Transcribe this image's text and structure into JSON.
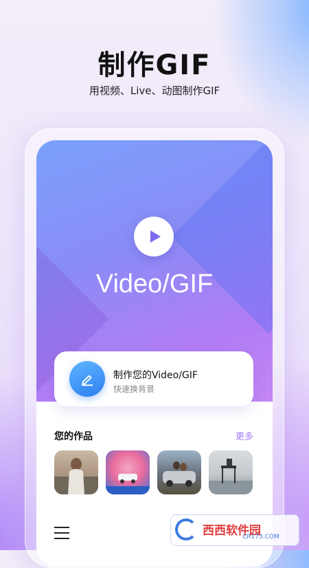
{
  "header": {
    "title": "制作GIF",
    "subtitle": "用视频、Live、动图制作GIF"
  },
  "hero": {
    "title": "Video/GIF",
    "play_icon": "play-icon"
  },
  "create_card": {
    "icon": "pencil-icon",
    "title": "制作您的Video/GIF",
    "subtitle": "快速换背景"
  },
  "works": {
    "title": "您的作品",
    "more_label": "更多",
    "thumbnails": [
      "woman-beach-photo",
      "pink-smoke-car-photo",
      "couple-car-photo",
      "pier-landscape-photo"
    ]
  },
  "bottom_bar": {
    "menu_icon": "menu-icon"
  },
  "watermark": {
    "text": "西西软件园",
    "url": "CR173.COM"
  },
  "colors": {
    "accent_purple": "#a17cf6",
    "button_blue": "#2e7ef0",
    "play_triangle": "#7c6cf2"
  }
}
